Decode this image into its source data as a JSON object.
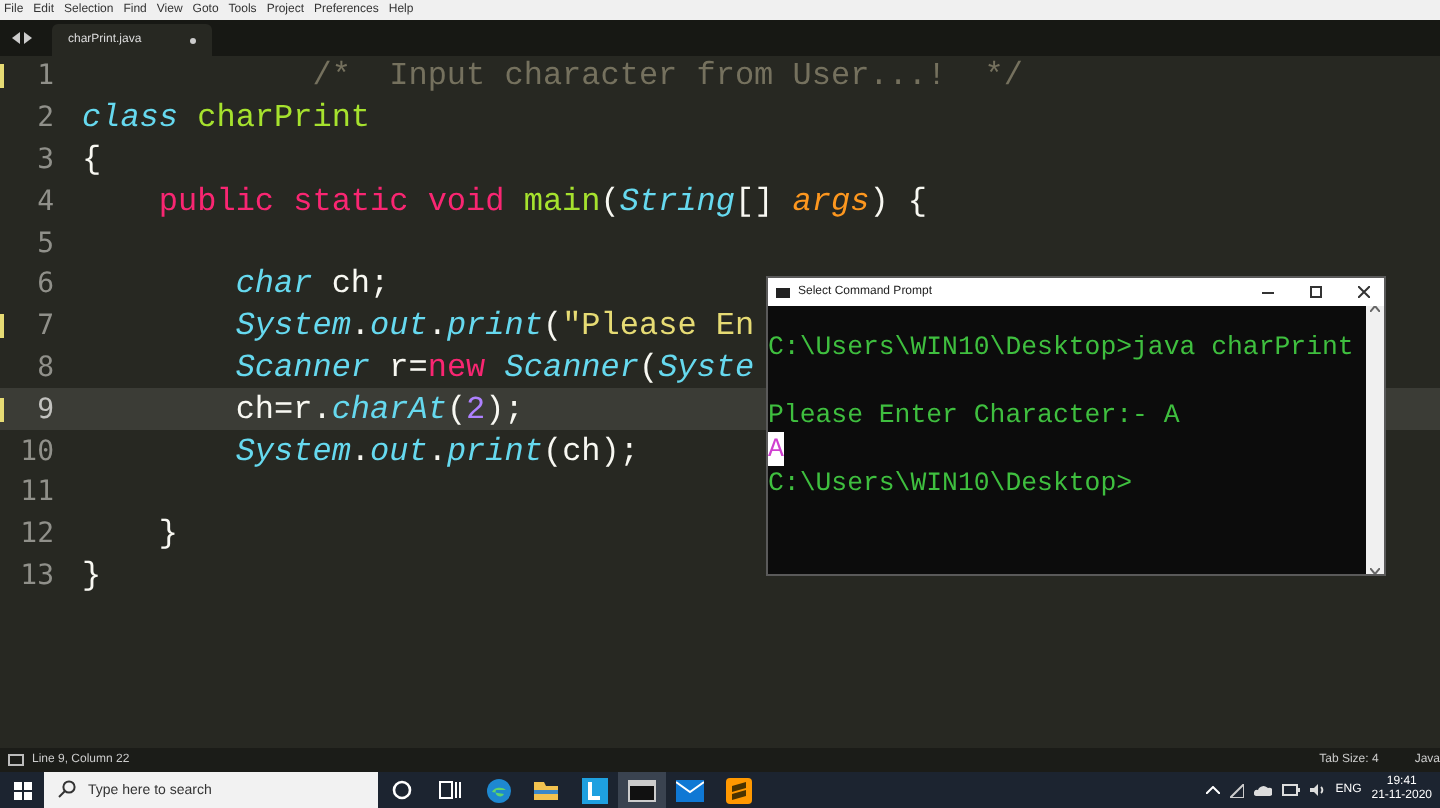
{
  "menu_bar": {
    "items": [
      "File",
      "Edit",
      "Selection",
      "Find",
      "View",
      "Goto",
      "Tools",
      "Project",
      "Preferences",
      "Help"
    ]
  },
  "tabs": [
    {
      "label": "charPrint.java",
      "selected": true,
      "modified": true
    }
  ],
  "editor": {
    "lines": [
      {
        "number": "1",
        "modified": true,
        "current": false,
        "tokens": [
          {
            "kind": "comment",
            "text": "            /*  Input character from User...!  */"
          }
        ]
      },
      {
        "number": "2",
        "modified": false,
        "current": false,
        "tokens": [
          {
            "kind": "storage",
            "text": "class"
          },
          {
            "kind": "entity",
            "text": " charPrint"
          }
        ]
      },
      {
        "number": "3",
        "modified": false,
        "current": false,
        "tokens": [
          {
            "kind": "plain",
            "text": "{"
          }
        ]
      },
      {
        "number": "4",
        "modified": false,
        "current": false,
        "tokens": [
          {
            "kind": "keyword",
            "text": "    public static void"
          },
          {
            "kind": "entity",
            "text": " main"
          },
          {
            "kind": "plain",
            "text": "("
          },
          {
            "kind": "storage",
            "text": "String"
          },
          {
            "kind": "plain",
            "text": "[] "
          },
          {
            "kind": "param",
            "text": "args"
          },
          {
            "kind": "plain",
            "text": ") {"
          }
        ]
      },
      {
        "number": "5",
        "modified": false,
        "current": false
      },
      {
        "number": "6",
        "modified": false,
        "current": false,
        "tokens": [
          {
            "kind": "storage",
            "text": "        char"
          },
          {
            "kind": "plain",
            "text": " ch;"
          }
        ]
      },
      {
        "number": "7",
        "modified": true,
        "current": false,
        "tokens": [
          {
            "kind": "storage",
            "text": "        System"
          },
          {
            "kind": "plain",
            "text": "."
          },
          {
            "kind": "storage",
            "text": "out"
          },
          {
            "kind": "plain",
            "text": "."
          },
          {
            "kind": "storage",
            "text": "print"
          },
          {
            "kind": "plain",
            "text": "("
          },
          {
            "kind": "string",
            "text": "\"Please En"
          }
        ]
      },
      {
        "number": "8",
        "modified": false,
        "current": false,
        "tokens": [
          {
            "kind": "storage",
            "text": "        Scanner"
          },
          {
            "kind": "plain",
            "text": " r="
          },
          {
            "kind": "keyword",
            "text": "new"
          },
          {
            "kind": "storage",
            "text": " Scanner"
          },
          {
            "kind": "plain",
            "text": "("
          },
          {
            "kind": "storage",
            "text": "Syste"
          }
        ]
      },
      {
        "number": "9",
        "modified": true,
        "current": true,
        "tokens": [
          {
            "kind": "plain",
            "text": "        ch=r."
          },
          {
            "kind": "storage",
            "text": "charAt"
          },
          {
            "kind": "plain",
            "text": "("
          },
          {
            "kind": "number",
            "text": "2"
          },
          {
            "kind": "plain",
            "text": ");"
          }
        ]
      },
      {
        "number": "10",
        "modified": false,
        "current": false,
        "tokens": [
          {
            "kind": "storage",
            "text": "        System"
          },
          {
            "kind": "plain",
            "text": "."
          },
          {
            "kind": "storage",
            "text": "out"
          },
          {
            "kind": "plain",
            "text": "."
          },
          {
            "kind": "storage",
            "text": "print"
          },
          {
            "kind": "plain",
            "text": "(ch);"
          }
        ]
      },
      {
        "number": "11",
        "modified": false,
        "current": false
      },
      {
        "number": "12",
        "modified": false,
        "current": false,
        "tokens": [
          {
            "kind": "plain",
            "text": "    }"
          }
        ]
      },
      {
        "number": "13",
        "modified": false,
        "current": false,
        "tokens": [
          {
            "kind": "plain",
            "text": "}"
          }
        ]
      }
    ]
  },
  "command_prompt": {
    "title": "Select Command Prompt",
    "lines": [
      {
        "text": "C:\\Users\\WIN10\\Desktop>java charPrint",
        "selected": false,
        "blank_before": false
      },
      {
        "text": "Please Enter Character:- A",
        "selected": false,
        "blank_before": true
      },
      {
        "text": "A",
        "selected": true,
        "blank_before": false
      },
      {
        "text": "C:\\Users\\WIN10\\Desktop>",
        "selected": false,
        "blank_before": false
      }
    ]
  },
  "status_bar": {
    "position": "Line 9, Column 22",
    "tab_size": "Tab Size: 4",
    "syntax": "Java"
  },
  "taskbar": {
    "search": {
      "placeholder": "Type here to search"
    },
    "apps": [
      {
        "kind": "cortana",
        "selected": false
      },
      {
        "kind": "task-view",
        "selected": false
      },
      {
        "kind": "browser",
        "selected": false
      },
      {
        "kind": "folder",
        "selected": false
      },
      {
        "kind": "letter",
        "selected": false
      },
      {
        "kind": "terminal",
        "selected": true
      },
      {
        "kind": "mail",
        "selected": false
      },
      {
        "kind": "editor",
        "selected": false
      }
    ],
    "tray": {
      "language": "ENG",
      "time": "19:41",
      "date": "21-11-2020"
    }
  }
}
